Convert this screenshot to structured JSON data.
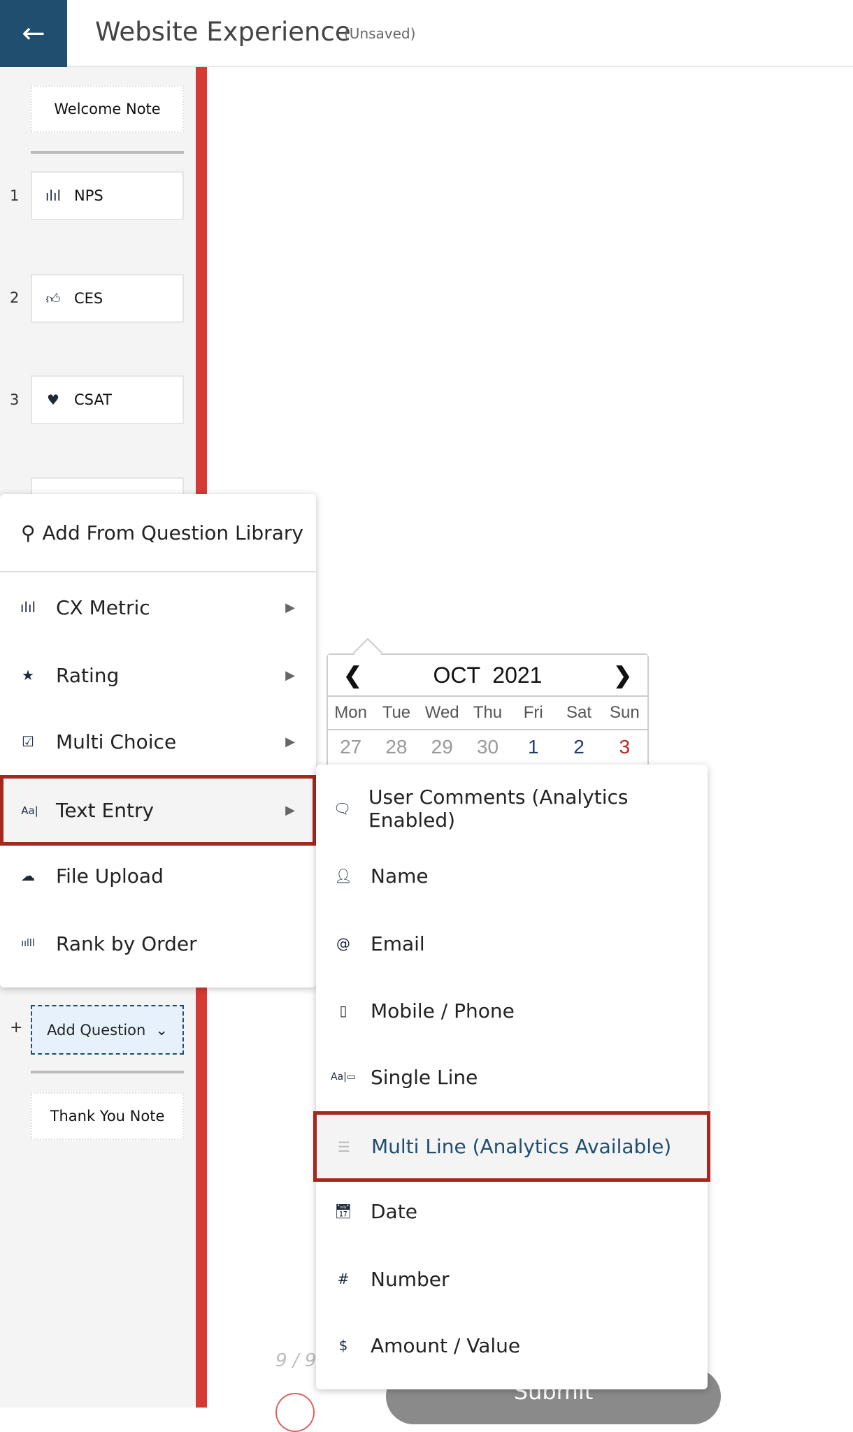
{
  "header": {
    "title": "Website Experience",
    "status": "(Unsaved)",
    "back_icon": "arrow-left-icon"
  },
  "sidebar": {
    "welcome": "Welcome Note",
    "questions": [
      {
        "num": "1",
        "label": "NPS",
        "icon": "nps-meter-icon"
      },
      {
        "num": "2",
        "label": "CES",
        "icon": "thumbs-up-icon"
      },
      {
        "num": "3",
        "label": "CSAT",
        "icon": "heart-icon"
      }
    ],
    "add_question": "Add Question",
    "add_plus": "+",
    "thank_you": "Thank You Note"
  },
  "menu": {
    "library": "Add From Question Library",
    "items": [
      {
        "label": "CX Metric",
        "icon": "nps-meter-icon"
      },
      {
        "label": "Rating",
        "icon": "star-icon"
      },
      {
        "label": "Multi Choice",
        "icon": "checkbox-icon"
      },
      {
        "label": "Text Entry",
        "icon": "text-icon",
        "selected": true
      },
      {
        "label": "File Upload",
        "icon": "cloud-upload-icon"
      },
      {
        "label": "Rank by Order",
        "icon": "bars-icon"
      }
    ]
  },
  "submenu": {
    "items": [
      {
        "label": "User Comments (Analytics Enabled)",
        "icon": "comment-icon"
      },
      {
        "label": "Name",
        "icon": "user-icon"
      },
      {
        "label": "Email",
        "icon": "at-icon"
      },
      {
        "label": "Mobile / Phone",
        "icon": "phone-icon"
      },
      {
        "label": "Single Line",
        "icon": "single-line-icon"
      },
      {
        "label": "Multi Line (Analytics Available)",
        "icon": "multi-line-icon",
        "selected": true
      },
      {
        "label": "Date",
        "icon": "calendar-icon"
      },
      {
        "label": "Number",
        "icon": "hash-icon"
      },
      {
        "label": "Amount / Value",
        "icon": "dollar-icon"
      }
    ]
  },
  "calendar": {
    "month": "OCT  2021",
    "days": [
      "Mon",
      "Tue",
      "Wed",
      "Thu",
      "Fri",
      "Sat",
      "Sun"
    ],
    "dates": [
      "27",
      "28",
      "29",
      "30",
      "1",
      "2",
      "3"
    ]
  },
  "footer": {
    "pager": "9 / 9",
    "submit": "Submit"
  },
  "colors": {
    "accent": "#1f4e6e",
    "red_bar": "#d63a35",
    "highlight_border": "#a5281f",
    "sunday": "#c0271d"
  }
}
